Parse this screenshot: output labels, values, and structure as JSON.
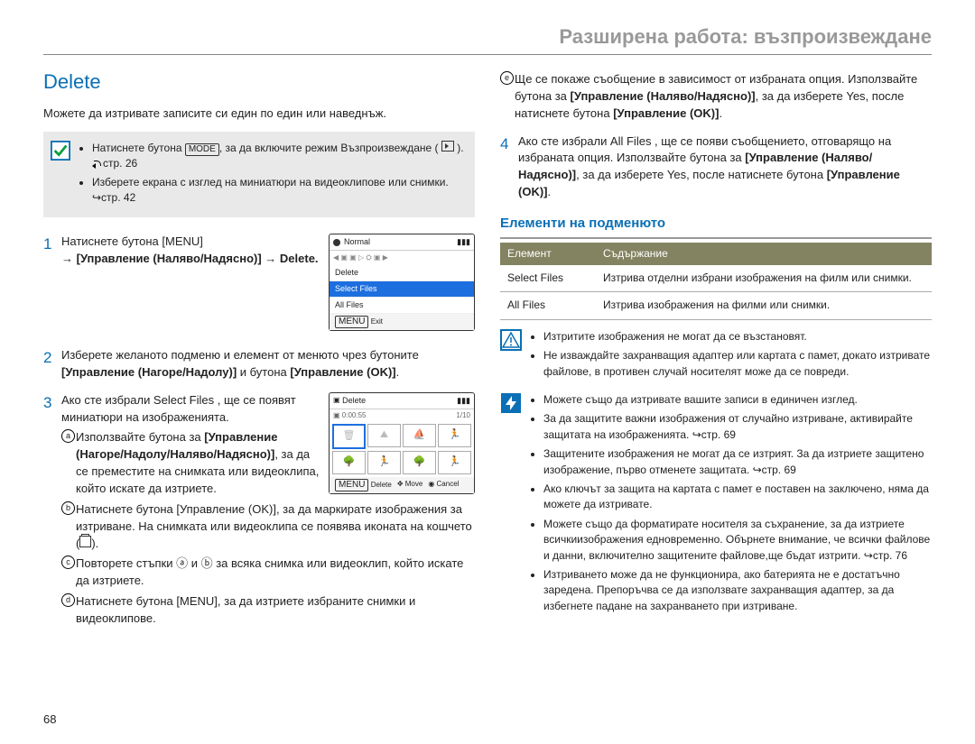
{
  "header": {
    "title": "Разширена работа: възпроизвеждане"
  },
  "page_number": "68",
  "section_title": "Delete",
  "intro": "Можете да изтривате записите си един по един или наведнъж.",
  "pre_note": {
    "items": [
      "Натиснете бутона [MODE], за да включите режим Възпроизвеждане ( ▶ ). ↪стр. 26",
      "Изберете екрана с изглед на миниатюри на видеоклипове или снимки. ↪стр. 42"
    ]
  },
  "screen_menu": {
    "top": "Normal",
    "rows": [
      "Delete",
      "Select Files",
      "All Files"
    ],
    "selected_index": 1,
    "exit": "Exit",
    "exit_btn": "MENU"
  },
  "screen_thumbs": {
    "title": "Delete",
    "time": "0:00:55",
    "counter": "1/10",
    "footer_delete": "Delete",
    "footer_move": "Move",
    "footer_cancel": "Cancel",
    "btn_menu": "MENU"
  },
  "steps": {
    "s1_a": "Натиснете бутона [MENU]",
    "s1_b": "→ [Управление (Наляво/Надясно)] → Delete.",
    "s2_a": "Изберете желаното подменю и елемент от менюто чрез бутоните [Управление (Нагоре/Надолу)] и бутона [Управление (OK)].",
    "s3_a": "Ако сте избрали Select Files , ще се появят миниатюри на изображенията.",
    "s3_sub": {
      "a": "Използвайте бутона за [Управление (Нагоре/Надолу/Наляво/Надясно)], за да се преместите на снимката или видеоклипа, който искате да изтриете.",
      "b_pre": "Натиснете бутона [Управление (OK)], за да маркирате изображения за изтриване. На снимката или видеоклипа се появява иконата на кошчето (",
      "b_post": ").",
      "c": "Повторете стъпки ⓐ и ⓑ за всяка снимка или видеоклип, който искате да изтриете.",
      "d": "Натиснете бутона [MENU], за да изтриете избраните снимки и видеоклипове.",
      "e": "Ще се покаже съобщение в зависимост от избраната опция. Използвайте бутона за [Управление (Наляво/Надясно)], за да изберете Yes, после натиснете бутона [Управление (OK)]."
    },
    "s4": "Ако сте избрали All Files , ще се появи съобщението, отговарящо на избраната опция. Използвайте бутона за [Управление (Наляво/Надясно)], за да изберете Yes, после натиснете бутона [Управление (OK)]."
  },
  "submenu": {
    "heading": "Елементи на подменюто",
    "th1": "Елемент",
    "th2": "Съдържание",
    "rows": [
      {
        "item": "Select Files",
        "desc": "Изтрива отделни избрани изображения на филм или снимки."
      },
      {
        "item": "All Files",
        "desc": "Изтрива изображения на филми или снимки."
      }
    ]
  },
  "caution": {
    "items": [
      "Изтритите изображения не могат да се възстановят.",
      "Не изваждайте захранващия адаптер или картата с памет, докато изтривате файлове, в противен случай носителят може да се повреди."
    ]
  },
  "info": {
    "items": [
      "Можете също да изтривате вашите записи в единичен изглед.",
      "За да защитите важни изображения от случайно изтриване, активирайте защитата на изображенията. ↪стр. 69",
      "Защитените изображения не могат да се изтрият. За да изтриете защитено изображение, първо отменете защитата. ↪стр. 69",
      "Ако ключът за защита на картата с памет е поставен на заключено, няма да можете да изтривате.",
      "Можете също да форматирате носителя за съхранение, за да изтриете всичкиизображения едновременно. Обърнете внимание, че всички файлове и данни, включително защитените файлове,ще бъдат изтрити. ↪стр. 76",
      "Изтриването може да не функционира, ако батерията не е достатъчно заредена. Препоръчва се да използвате захранващия адаптер, за да избегнете падане на захранването при изтриване."
    ]
  }
}
